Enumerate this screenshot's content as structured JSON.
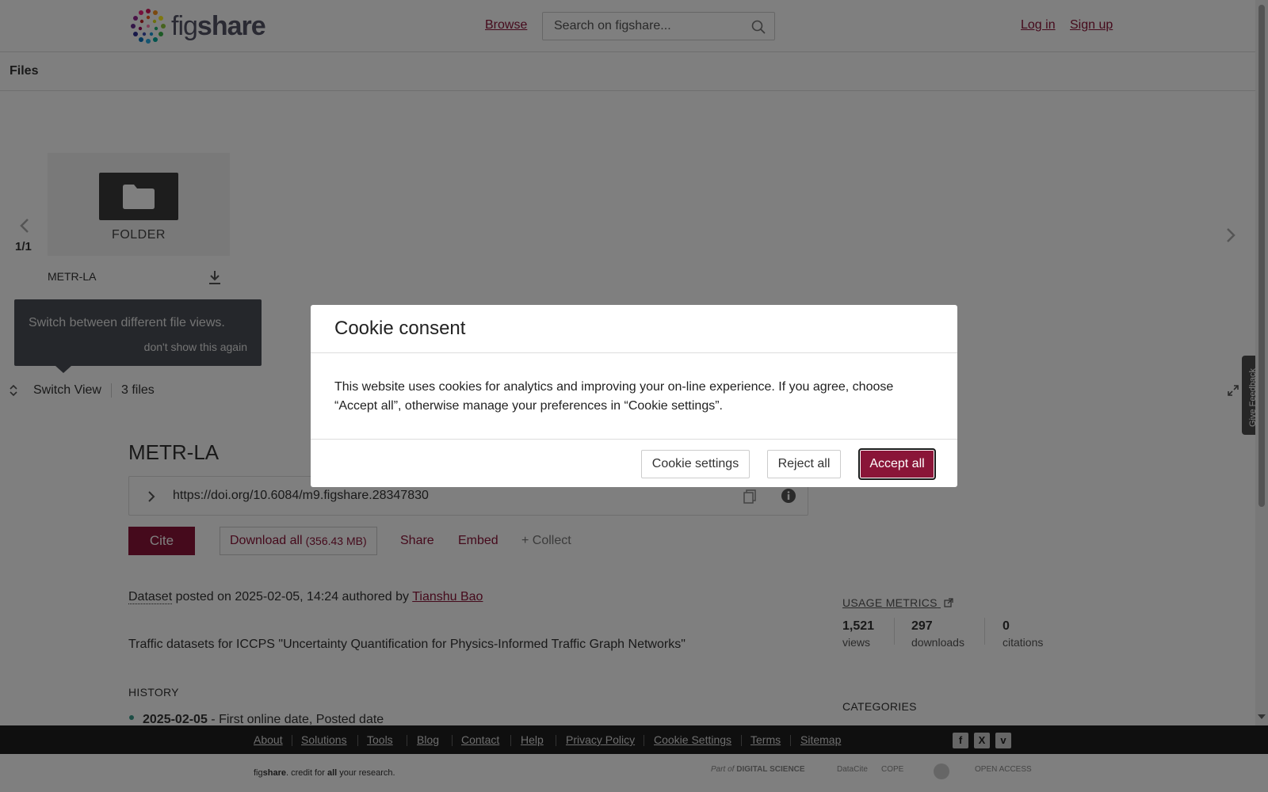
{
  "header": {
    "logo_text_light": "fig",
    "logo_text_bold": "share",
    "browse_label": "Browse",
    "search_placeholder": "Search on figshare...",
    "login_label": "Log in",
    "signup_label": "Sign up"
  },
  "files_bar": {
    "title": "Files"
  },
  "viewer": {
    "page_counter": "1/1",
    "folder_label": "FOLDER",
    "file_name": "METR-LA",
    "tooltip_text": "Switch between different file views.",
    "tooltip_dismiss": "don't show this again",
    "switch_view_label": "Switch View",
    "files_count": "3 files"
  },
  "item": {
    "title": "METR-LA",
    "doi": "https://doi.org/10.6084/m9.figshare.28347830",
    "cite_label": "Cite",
    "download_all_label": "Download all",
    "download_all_size": "(356.43 MB)",
    "share_label": "Share",
    "embed_label": "Embed",
    "collect_label": "+ Collect",
    "type_label": "Dataset",
    "posted_text": " posted on 2025-02-05, 14:24 authored by ",
    "author": "Tianshu Bao",
    "description": "Traffic datasets for ICCPS \"Uncertainty Quantification for Physics-Informed Traffic Graph Networks\"",
    "history_label": "HISTORY",
    "history_date": "2025-02-05",
    "history_text": " - First online date, Posted date"
  },
  "metrics": {
    "link_label": "USAGE METRICS",
    "views_num": "1,521",
    "views_label": "views",
    "downloads_num": "297",
    "downloads_label": "downloads",
    "citations_num": "0",
    "citations_label": "citations",
    "categories_label": "CATEGORIES"
  },
  "feedback": {
    "label": "Give Feedback"
  },
  "footer": {
    "links": [
      "About",
      "Solutions",
      "Tools",
      "Blog",
      "Contact",
      "Help",
      "Privacy Policy",
      "Cookie Settings",
      "Terms",
      "Sitemap"
    ],
    "tagline_fig": "fig",
    "tagline_share": "share",
    "tagline_rest1": ". credit for ",
    "tagline_all": "all",
    "tagline_rest2": " your research.",
    "partner_part_of": "Part of",
    "partner_ds": "DIGITAL SCIENCE",
    "partner_datacite": "DataCite",
    "partner_cope": "COPE",
    "partner_oa": "OPEN ACCESS"
  },
  "cookie_modal": {
    "title": "Cookie consent",
    "body": "This website uses cookies for analytics and improving your on-line experience. If you agree, choose “Accept all”, otherwise manage your preferences in “Cookie settings”.",
    "settings_label": "Cookie settings",
    "reject_label": "Reject all",
    "accept_label": "Accept all"
  },
  "colors": {
    "brand": "#8a1538",
    "tooltip_bg": "#4a4f57",
    "footer_bg": "#1e1e1e",
    "accent_dot": "#3a9a8a"
  }
}
